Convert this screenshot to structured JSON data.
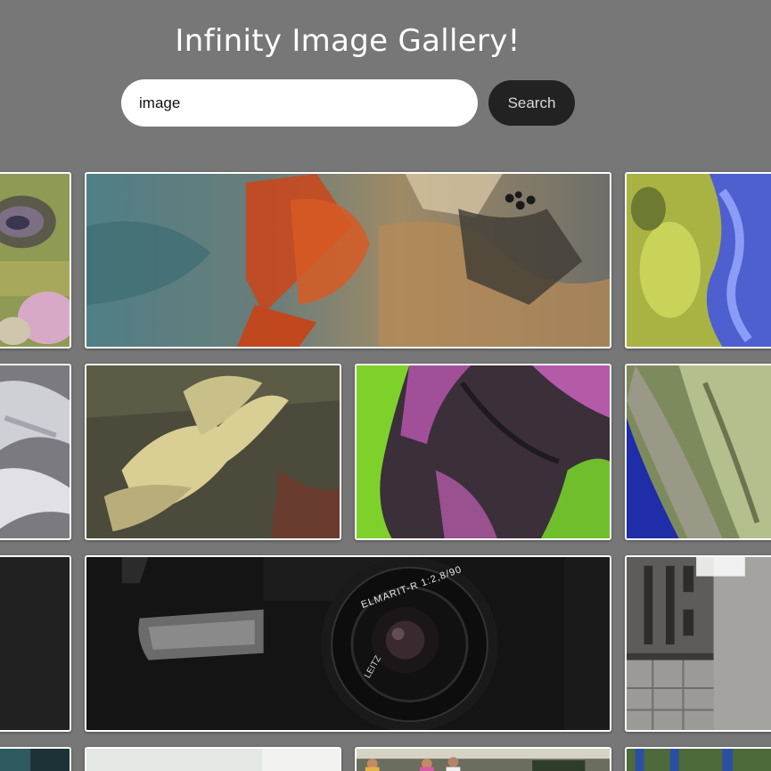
{
  "app": {
    "title": "Infinity Image Gallery!"
  },
  "search": {
    "value": "image",
    "button_label": "Search"
  },
  "colors": {
    "background": "#777777",
    "search_button": "#222222",
    "tile_border": "#ffffff"
  },
  "gallery": {
    "tiles": [
      {
        "name": "gallery-image-earth-desert-left",
        "subject": "satellite terrain"
      },
      {
        "name": "gallery-image-earth-orange-dunes",
        "subject": "satellite desert"
      },
      {
        "name": "gallery-image-earth-blue-river",
        "subject": "satellite delta"
      },
      {
        "name": "gallery-image-earth-snow",
        "subject": "satellite snow"
      },
      {
        "name": "gallery-image-earth-yellow-feather",
        "subject": "satellite feather pattern"
      },
      {
        "name": "gallery-image-earth-green-purple",
        "subject": "satellite green purple"
      },
      {
        "name": "gallery-image-earth-ridges",
        "subject": "satellite ridges"
      },
      {
        "name": "gallery-image-dark-left",
        "subject": "dark photo"
      },
      {
        "name": "gallery-image-camera-lens",
        "subject": "camera lens"
      },
      {
        "name": "gallery-image-building",
        "subject": "building facade"
      },
      {
        "name": "gallery-image-bottom-1",
        "subject": "partial"
      },
      {
        "name": "gallery-image-bottom-2",
        "subject": "partial"
      },
      {
        "name": "gallery-image-bottom-3",
        "subject": "runners"
      },
      {
        "name": "gallery-image-bottom-4",
        "subject": "partial"
      }
    ],
    "lens_text_1": "ELMARIT-R 1:2,8/90",
    "lens_text_2": "LEITZ"
  }
}
